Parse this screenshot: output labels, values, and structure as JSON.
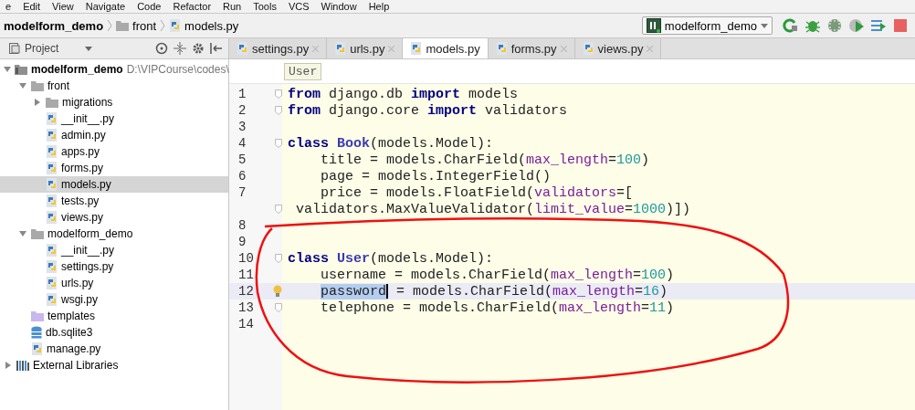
{
  "menu": [
    "e",
    "Edit",
    "View",
    "Navigate",
    "Code",
    "Refactor",
    "Run",
    "Tools",
    "VCS",
    "Window",
    "Help"
  ],
  "breadcrumb": [
    {
      "kind": "project",
      "label": "modelform_demo"
    },
    {
      "kind": "folder",
      "label": "front"
    },
    {
      "kind": "pyfile",
      "label": "models.py"
    }
  ],
  "run_config": {
    "label": "modelform_demo"
  },
  "project_panel": {
    "title": "Project",
    "tree": [
      {
        "kind": "module",
        "label": "modelform_demo",
        "path": "D:\\VIPCourse\\codes\\",
        "expanded": true,
        "selected": false,
        "children": [
          {
            "kind": "folder",
            "label": "front",
            "expanded": true,
            "selected": false,
            "children": [
              {
                "kind": "folder",
                "label": "migrations",
                "expanded": false,
                "selected": false
              },
              {
                "kind": "pyfile",
                "label": "__init__.py",
                "selected": false
              },
              {
                "kind": "pyfile",
                "label": "admin.py",
                "selected": false
              },
              {
                "kind": "pyfile",
                "label": "apps.py",
                "selected": false
              },
              {
                "kind": "pyfile",
                "label": "forms.py",
                "selected": false
              },
              {
                "kind": "pyfile",
                "label": "models.py",
                "selected": true
              },
              {
                "kind": "pyfile",
                "label": "tests.py",
                "selected": false
              },
              {
                "kind": "pyfile",
                "label": "views.py",
                "selected": false
              }
            ]
          },
          {
            "kind": "folder",
            "label": "modelform_demo",
            "expanded": true,
            "selected": false,
            "children": [
              {
                "kind": "pyfile",
                "label": "__init__.py",
                "selected": false
              },
              {
                "kind": "pyfile",
                "label": "settings.py",
                "selected": false
              },
              {
                "kind": "pyfile",
                "label": "urls.py",
                "selected": false
              },
              {
                "kind": "pyfile",
                "label": "wsgi.py",
                "selected": false
              }
            ]
          },
          {
            "kind": "templates",
            "label": "templates",
            "selected": false
          },
          {
            "kind": "db",
            "label": "db.sqlite3",
            "selected": false
          },
          {
            "kind": "pyfile",
            "label": "manage.py",
            "selected": false
          }
        ]
      },
      {
        "kind": "library",
        "label": "External Libraries",
        "expanded": false,
        "selected": false
      }
    ]
  },
  "tabs": [
    {
      "label": "settings.py",
      "selected": false
    },
    {
      "label": "urls.py",
      "selected": false
    },
    {
      "label": "models.py",
      "selected": true
    },
    {
      "label": "forms.py",
      "selected": false
    },
    {
      "label": "views.py",
      "selected": false
    }
  ],
  "editor": {
    "breadcrumb": "User",
    "lines": [
      {
        "number": "1",
        "fold": true,
        "tokens": [
          {
            "kind": "kw",
            "text": "from"
          },
          {
            "kind": "plain",
            "text": " django.db "
          },
          {
            "kind": "kw",
            "text": "import"
          },
          {
            "kind": "plain",
            "text": " models"
          }
        ]
      },
      {
        "number": "2",
        "fold": true,
        "tokens": [
          {
            "kind": "kw",
            "text": "from"
          },
          {
            "kind": "plain",
            "text": " django.core "
          },
          {
            "kind": "kw",
            "text": "import"
          },
          {
            "kind": "plain",
            "text": " validators"
          }
        ]
      },
      {
        "number": "3"
      },
      {
        "number": "4",
        "fold": true,
        "tokens": [
          {
            "kind": "kw",
            "text": "class "
          },
          {
            "kind": "cls",
            "text": "Book"
          },
          {
            "kind": "plain",
            "text": "(models.Model):"
          }
        ]
      },
      {
        "number": "5",
        "indented": true,
        "tokens": [
          {
            "kind": "plain",
            "text": "title = models.CharField("
          },
          {
            "kind": "param",
            "text": "max_length"
          },
          {
            "kind": "plain",
            "text": "="
          },
          {
            "kind": "num",
            "text": "100"
          },
          {
            "kind": "plain",
            "text": ")"
          }
        ]
      },
      {
        "number": "6",
        "indented": true,
        "tokens": [
          {
            "kind": "plain",
            "text": "page = models.IntegerField()"
          }
        ]
      },
      {
        "number": "7",
        "indented": true,
        "tokens": [
          {
            "kind": "plain",
            "text": "price = models.FloatField("
          },
          {
            "kind": "param",
            "text": "validators"
          },
          {
            "kind": "plain",
            "text": "=["
          }
        ]
      },
      {
        "fold": true,
        "tokens": [
          {
            "kind": "plain",
            "text": " validators.MaxValueValidator("
          },
          {
            "kind": "param",
            "text": "limit_value"
          },
          {
            "kind": "plain",
            "text": "="
          },
          {
            "kind": "num",
            "text": "1000"
          },
          {
            "kind": "plain",
            "text": ")])"
          }
        ]
      },
      {
        "number": "8"
      },
      {
        "number": "9"
      },
      {
        "number": "10",
        "fold": true,
        "tokens": [
          {
            "kind": "kw",
            "text": "class "
          },
          {
            "kind": "cls",
            "text": "User"
          },
          {
            "kind": "plain",
            "text": "(models.Model):"
          }
        ]
      },
      {
        "number": "11",
        "indented": true,
        "tokens": [
          {
            "kind": "plain",
            "text": "username = models.CharField("
          },
          {
            "kind": "param",
            "text": "max_length"
          },
          {
            "kind": "plain",
            "text": "="
          },
          {
            "kind": "num",
            "text": "100"
          },
          {
            "kind": "plain",
            "text": ")"
          }
        ]
      },
      {
        "number": "12",
        "current": true,
        "bulb": true,
        "indented": true,
        "tokens": [
          {
            "kind": "sel",
            "text": "password"
          },
          {
            "kind": "plain",
            "text": " = models.CharField("
          },
          {
            "kind": "param",
            "text": "max_length"
          },
          {
            "kind": "plain",
            "text": "="
          },
          {
            "kind": "num",
            "text": "16"
          },
          {
            "kind": "plain",
            "text": ")"
          }
        ]
      },
      {
        "number": "13",
        "fold": true,
        "indented": true,
        "tokens": [
          {
            "kind": "plain",
            "text": "telephone = models.CharField("
          },
          {
            "kind": "param",
            "text": "max_length"
          },
          {
            "kind": "plain",
            "text": "="
          },
          {
            "kind": "num",
            "text": "11"
          },
          {
            "kind": "plain",
            "text": ")"
          }
        ]
      },
      {
        "number": "14"
      }
    ]
  }
}
